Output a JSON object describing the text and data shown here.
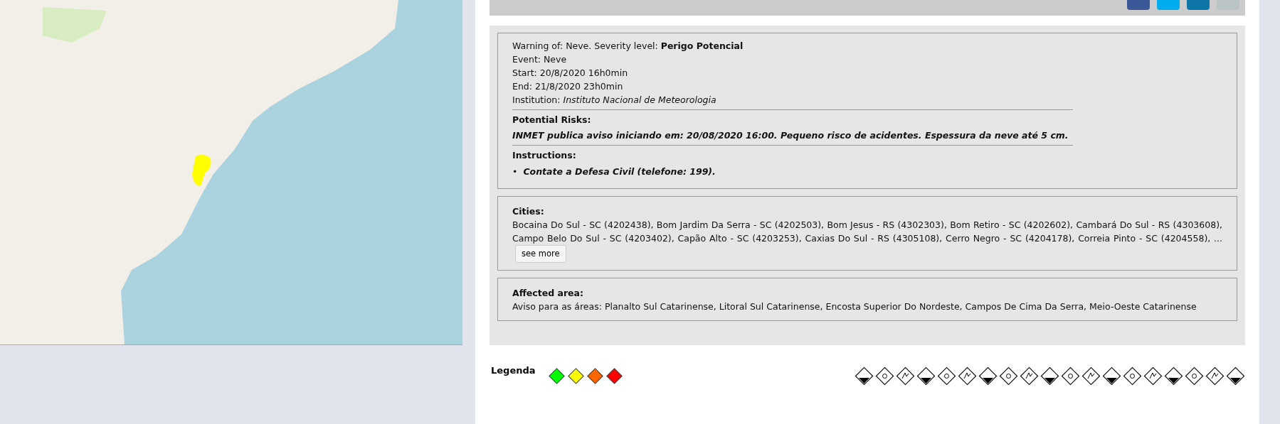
{
  "warning": {
    "heading_label": "Warning of: Neve. Severity level: ",
    "severity": "Perigo Potencial",
    "event": "Event: Neve",
    "start": "Start: 20/8/2020 16h0min",
    "end": "End: 21/8/2020 23h0min",
    "institution_label": "Institution: ",
    "institution": "Instituto Nacional de Meteorologia",
    "risks_title": "Potential Risks:",
    "risks": "INMET publica aviso iniciando em: 20/08/2020 16:00. Pequeno risco de acidentes. Espessura da neve até 5 cm.",
    "instructions_title": "Instructions:",
    "bullet": "•",
    "instructions": [
      "Contate a Defesa Civil (telefone: 199)."
    ]
  },
  "cities": {
    "title": "Cities:",
    "text": "Bocaina Do Sul - SC (4202438), Bom Jardim Da Serra - SC (4202503), Bom Jesus - RS (4302303), Bom Retiro - SC (4202602), Cambará Do Sul - RS (4303608), Campo Belo Do Sul - SC (4203402), Capão Alto - SC (4203253), Caxias Do Sul - RS (4305108), Cerro Negro - SC (4204178), Correia Pinto - SC (4204558), ...",
    "see_more": "see more"
  },
  "affected_area": {
    "title": "Affected area:",
    "text": "Aviso para as áreas: Planalto Sul Catarinense, Litoral Sul Catarinense, Encosta Superior Do Nordeste, Campos De Cima Da Serra, Meio-Oeste Catarinense"
  },
  "legend": {
    "title": "Legenda",
    "levels": [
      {
        "color": "#00ff00"
      },
      {
        "color": "#ffff00"
      },
      {
        "color": "#ff6600"
      },
      {
        "color": "#ff0000"
      }
    ]
  }
}
